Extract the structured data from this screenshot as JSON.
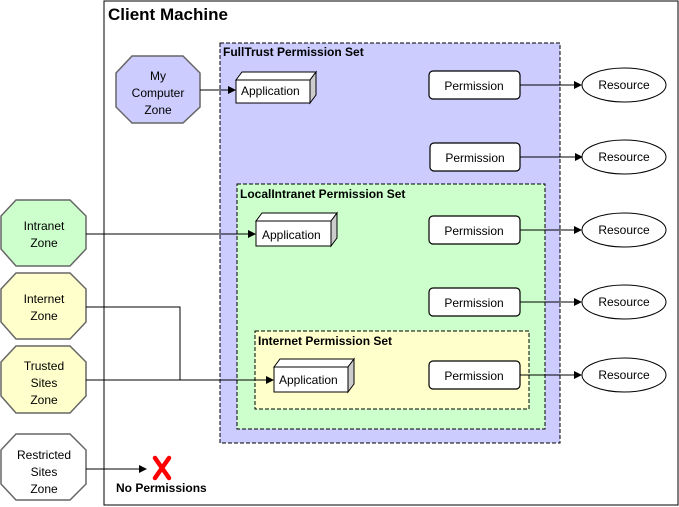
{
  "client_machine": {
    "title": "Client Machine"
  },
  "permission_sets": {
    "fulltrust": {
      "title": "FullTrust Permission Set",
      "color": "#ccccff"
    },
    "localintranet": {
      "title": "LocalIntranet Permission Set",
      "color": "#ccffcc"
    },
    "internet": {
      "title": "Internet Permission Set",
      "color": "#ffffcc"
    }
  },
  "zones": {
    "my_computer": {
      "lines": [
        "My",
        "Computer",
        "Zone"
      ],
      "color": "#ccccff"
    },
    "intranet": {
      "lines": [
        "Intranet",
        "Zone"
      ],
      "color": "#ccffcc"
    },
    "internet": {
      "lines": [
        "Internet",
        "Zone"
      ],
      "color": "#ffffcc"
    },
    "trusted": {
      "lines": [
        "Trusted",
        "Sites",
        "Zone"
      ],
      "color": "#ffffcc"
    },
    "restricted": {
      "lines": [
        "Restricted",
        "Sites",
        "Zone"
      ],
      "color": "#ffffff"
    }
  },
  "application_label": "Application",
  "permission_label": "Permission",
  "resource_label": "Resource",
  "no_permissions": {
    "label": "No Permissions",
    "color": "#ff0000"
  }
}
